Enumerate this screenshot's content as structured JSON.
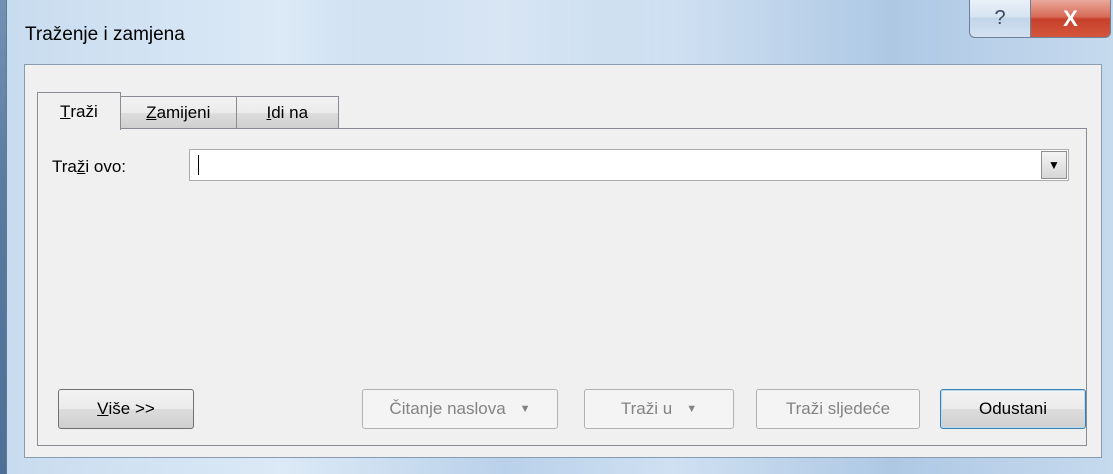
{
  "window": {
    "title": "Traženje i zamjena",
    "help_icon": "help-question-icon",
    "close_icon": "close-x-icon",
    "help_glyph": "?",
    "close_glyph": "X"
  },
  "tabs": [
    {
      "prefix": "",
      "accel": "T",
      "rest": "raži",
      "active": true
    },
    {
      "prefix": "",
      "accel": "Z",
      "rest": "amijeni",
      "active": false
    },
    {
      "prefix": "",
      "accel": "I",
      "rest": "di na",
      "active": false
    }
  ],
  "find": {
    "label_prefix": "Tra",
    "label_accel": "ž",
    "label_rest": "i ovo:",
    "value": "",
    "dropdown_glyph": "▼"
  },
  "buttons": {
    "more": {
      "accel": "V",
      "rest": "iše >>"
    },
    "reading_highlight": {
      "label": "Čitanje naslova",
      "arrow": "▼",
      "enabled": false
    },
    "find_in": {
      "label": "Traži u",
      "arrow": "▼",
      "enabled": false
    },
    "find_next": {
      "label": "Traži sljedeće",
      "enabled": false
    },
    "cancel": {
      "label": "Odustani",
      "enabled": true
    }
  }
}
